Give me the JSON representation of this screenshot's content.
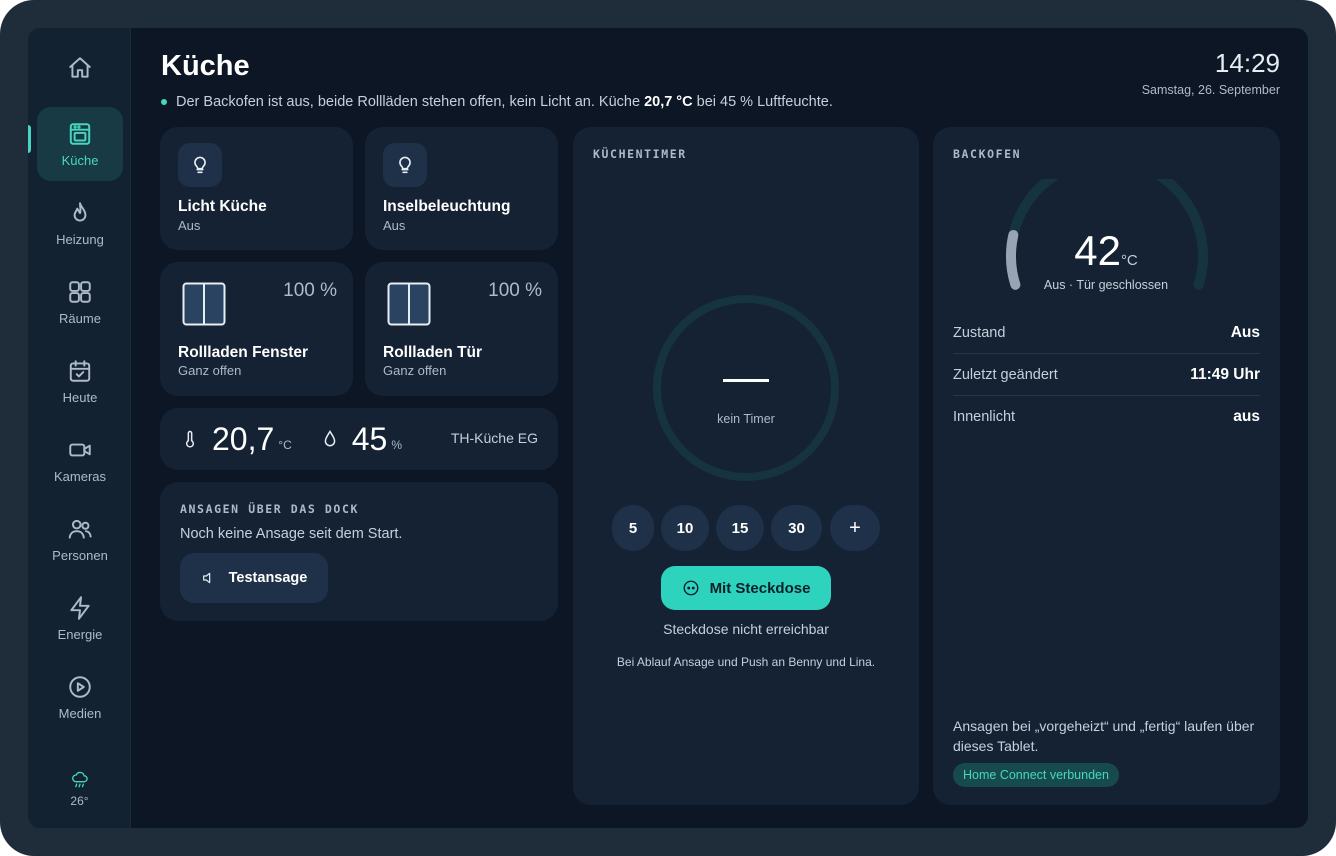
{
  "sidebar": {
    "items": [
      {
        "label": "",
        "icon": "home-icon"
      },
      {
        "label": "Küche",
        "icon": "oven-icon",
        "active": true
      },
      {
        "label": "Heizung",
        "icon": "flame-icon"
      },
      {
        "label": "Räume",
        "icon": "grid-icon"
      },
      {
        "label": "Heute",
        "icon": "calendar-check-icon"
      },
      {
        "label": "Kameras",
        "icon": "video-icon"
      },
      {
        "label": "Personen",
        "icon": "users-icon"
      },
      {
        "label": "Energie",
        "icon": "bolt-icon"
      },
      {
        "label": "Medien",
        "icon": "play-circle-icon"
      }
    ],
    "weather": {
      "temp": "26°",
      "icon": "cloud-rain-icon"
    }
  },
  "header": {
    "title": "Küche",
    "summary_pre": "Der Backofen ist aus, beide Rollläden stehen offen, kein Licht an. Küche",
    "summary_temp": "20,7 °C",
    "summary_post": "bei 45 % Luftfeuchte.",
    "time": "14:29",
    "date": "Samstag, 26. September"
  },
  "lights": [
    {
      "title": "Licht Küche",
      "state": "Aus"
    },
    {
      "title": "Inselbeleuchtung",
      "state": "Aus"
    }
  ],
  "shutters": [
    {
      "title": "Rollladen Fenster",
      "state": "Ganz offen",
      "percent": "100 %"
    },
    {
      "title": "Rollladen Tür",
      "state": "Ganz offen",
      "percent": "100 %"
    }
  ],
  "climate": {
    "temperature": "20,7",
    "temperature_unit": "°C",
    "humidity": "45",
    "humidity_unit": "%",
    "sensor": "TH-Küche EG"
  },
  "announcements": {
    "label": "ANSAGEN ÜBER DAS DOCK",
    "text": "Noch keine Ansage seit dem Start.",
    "button": "Testansage"
  },
  "timer": {
    "label": "KÜCHENTIMER",
    "display": "—",
    "status": "kein Timer",
    "presets": [
      "5",
      "10",
      "15",
      "30",
      "+"
    ],
    "plug_button": "Mit Steckdose",
    "plug_status": "Steckdose nicht erreichbar",
    "note": "Bei Ablauf Ansage und Push an Benny und Lina."
  },
  "oven": {
    "label": "BACKOFEN",
    "temperature": "42",
    "unit": "°C",
    "status": "Aus · Tür geschlossen",
    "gauge_fill_fraction": 0.14,
    "rows": [
      {
        "key": "Zustand",
        "value": "Aus"
      },
      {
        "key": "Zuletzt geändert",
        "value": "11:49 Uhr"
      },
      {
        "key": "Innenlicht",
        "value": "aus"
      }
    ],
    "note": "Ansagen bei „vorgeheizt“ und „fertig“ laufen über dieses Tablet.",
    "badge": "Home Connect verbunden"
  },
  "colors": {
    "accent": "#2ed3bd",
    "background": "#0c1624",
    "card": "#142234"
  }
}
